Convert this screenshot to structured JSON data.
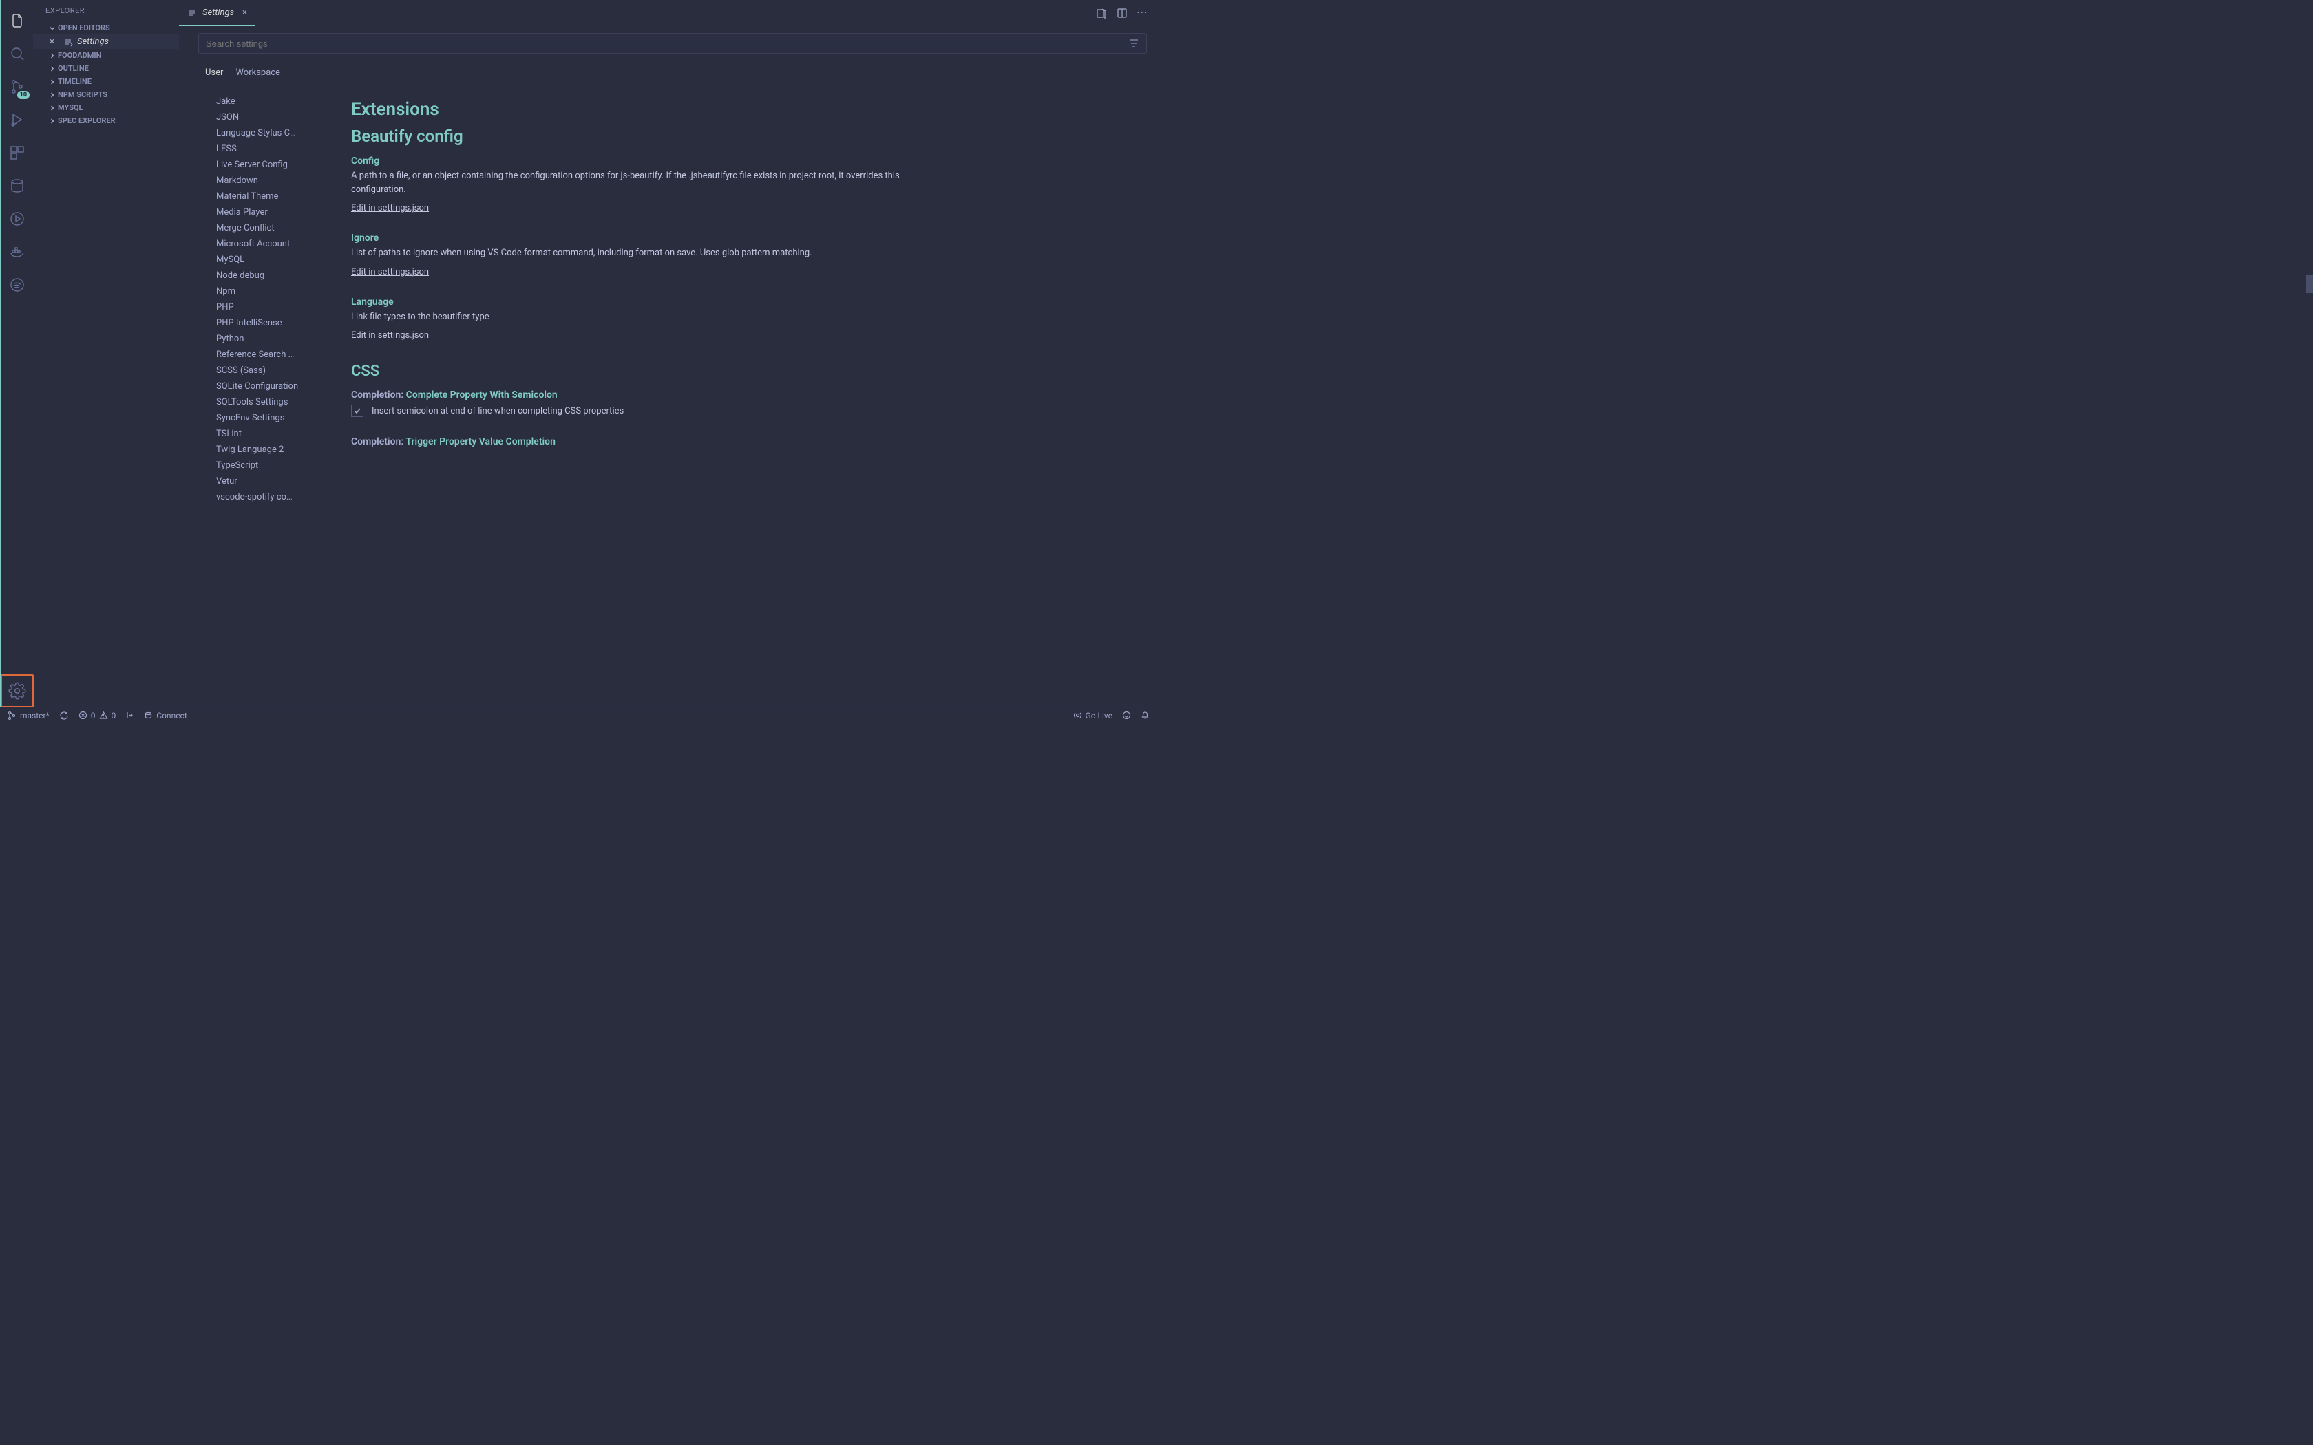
{
  "sidebar": {
    "title": "EXPLORER",
    "sections": [
      "OPEN EDITORS",
      "FOODADMIN",
      "OUTLINE",
      "TIMELINE",
      "NPM SCRIPTS",
      "MYSQL",
      "SPEC EXPLORER"
    ],
    "open_file": "Settings"
  },
  "activity": {
    "badge": "10"
  },
  "tab": {
    "label": "Settings"
  },
  "settings": {
    "search_placeholder": "Search settings",
    "scopes": [
      "User",
      "Workspace"
    ],
    "toc": [
      "Jake",
      "JSON",
      "Language Stylus C…",
      "LESS",
      "Live Server Config",
      "Markdown",
      "Material Theme",
      "Media Player",
      "Merge Conflict",
      "Microsoft Account",
      "MySQL",
      "Node debug",
      "Npm",
      "PHP",
      "PHP IntelliSense",
      "Python",
      "Reference Search …",
      "SCSS (Sass)",
      "SQLite Configuration",
      "SQLTools Settings",
      "SyncEnv Settings",
      "TSLint",
      "Twig Language 2",
      "TypeScript",
      "Vetur",
      "vscode-spotify co…"
    ],
    "h1": "Extensions",
    "h2": "Beautify config",
    "blocks": [
      {
        "title": "Config",
        "desc": "A path to a file, or an object containing the configuration options for js-beautify. If the .jsbeautifyrc file exists in project root, it overrides this configuration.",
        "link": "Edit in settings.json"
      },
      {
        "title": "Ignore",
        "desc": "List of paths to ignore when using VS Code format command, including format on save. Uses glob pattern matching.",
        "link": "Edit in settings.json"
      },
      {
        "title": "Language",
        "desc": "Link file types to the beautifier type",
        "link": "Edit in settings.json"
      }
    ],
    "css_h": "CSS",
    "css_completion": {
      "prefix": "Completion: ",
      "label": "Complete Property With Semicolon",
      "checkbox_label": "Insert semicolon at end of line when completing CSS properties"
    },
    "css_completion2": {
      "prefix": "Completion: ",
      "label": "Trigger Property Value Completion"
    }
  },
  "status": {
    "branch": "master*",
    "errors": "0",
    "warnings": "0",
    "connect": "Connect",
    "golive": "Go Live"
  }
}
